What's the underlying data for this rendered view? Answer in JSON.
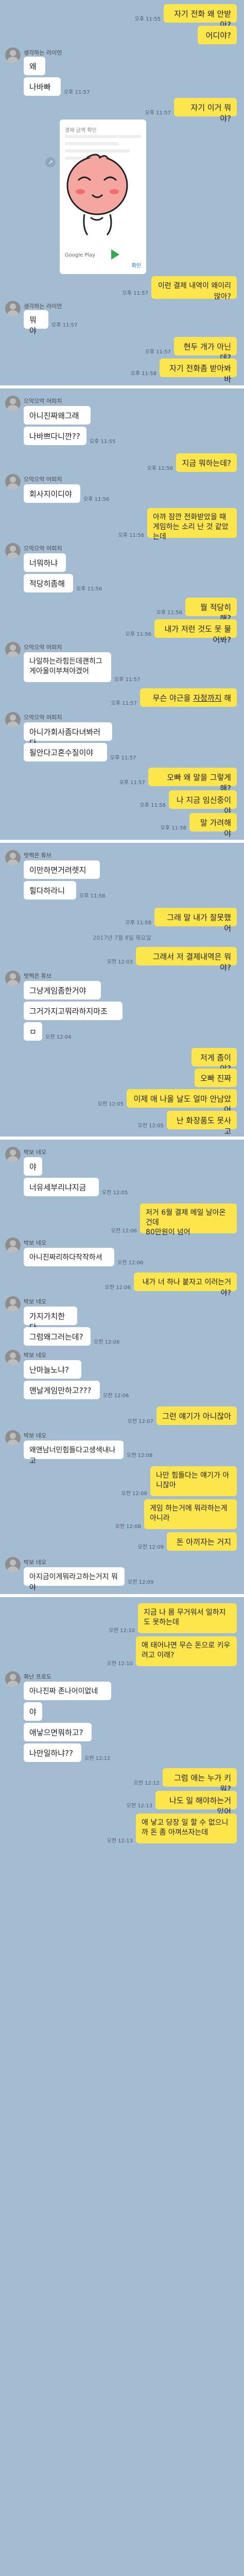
{
  "section1": {
    "m1": {
      "text": "자기 전화 왜 안받아?",
      "time": "오후 11:55"
    },
    "m2": {
      "text": "어디야?"
    },
    "name": "생각하는 라이언",
    "m3": {
      "text": "왜"
    },
    "m4": {
      "text": "나바빠",
      "time": "오후 11:57"
    },
    "m5": {
      "text": "자기 이거 뭐야?",
      "time": "오후 11:57"
    },
    "card": {
      "heading": "결제 금액 확인",
      "store": "Google Play",
      "cta": "확인"
    },
    "m6": {
      "text": "이런 결제 내역이 왜이리 많아?",
      "time": "오후 11:57"
    },
    "m7": {
      "text": "뭐야",
      "time": "오후 11:57"
    },
    "m8": {
      "text": "현두 개가 아닌데?",
      "time": "오후 11:57"
    },
    "m9": {
      "text": "자기 전화좀 받아봐바",
      "time": "오후 11:58"
    }
  },
  "section2": {
    "name": "으악으악 어피치",
    "m1": {
      "text": "아니진짜왜그래"
    },
    "m2": {
      "text": "나바쁘다니깐??",
      "time": "오후 11:55"
    },
    "m3": {
      "text": "지금 뭐하는데?",
      "time": "오후 11:56"
    },
    "m4": {
      "text": "회사지이디야",
      "time": "오후 11:56"
    },
    "m5": {
      "text": "아까 잠깐 전화받았을 때 게임하는 소리 난 것 같았는데",
      "time": "오후 11:56"
    },
    "m6": {
      "text": "너뭐하냐"
    },
    "m7": {
      "text": "적당히좀해",
      "time": "오후 11:56"
    },
    "m8": {
      "text": "뭘 적당히 해?",
      "time": "오후 11:56"
    },
    "m9": {
      "text": "내가 저런 것도 못 물어봐?",
      "time": "오후 11:56"
    },
    "m10": {
      "text": "나일하는라힘든데괜히그게아울이부쳐야겠어",
      "time": "오후 11:57"
    },
    "m11a": {
      "text": "무슨 야근을 "
    },
    "m11b": {
      "text": "자정까지"
    },
    "m11c": {
      "text": " 해",
      "time": "오후 11:57"
    },
    "m12": {
      "text": "아니가회사좀다녀봐러다"
    },
    "m13": {
      "text": "될안다고혼수질이야",
      "time": "오후 11:57"
    },
    "m14": {
      "text": "오빠 왜 말을 그렇게 해?",
      "time": "오후 11:57"
    },
    "m15": {
      "text": "나 지금 임신중이야",
      "time": "오후 11:58"
    },
    "m16": {
      "text": "말 가려해야",
      "time": "오후 11:58"
    }
  },
  "section3": {
    "name": "멋쩍은 튜브",
    "m1": {
      "text": "이만하면거려렛지"
    },
    "m2": {
      "text": "힐다하라니",
      "time": "오후 11:58"
    },
    "m3": {
      "text": "그래 말 내가 잘못했어",
      "time": "오후 11:58"
    },
    "date": "2017년 7월 8일 목요일",
    "m4": {
      "text": "그래서 저 결제내역은 뭐야?",
      "time": "오전 12:03"
    },
    "m5": {
      "text": "그냥게임좀한거야"
    },
    "m6": {
      "text": "그거가지고뭐라하지마조"
    },
    "m7": {
      "text": "ㅁ",
      "time": "오전 12:04"
    },
    "m8": {
      "text": "저게 좀이야?"
    },
    "m9": {
      "text": "오빠 진짜"
    },
    "m10": {
      "text": "이제 애 나올 날도 얼마 안남았어",
      "time": "오전 12:05"
    },
    "m11": {
      "text": "난 화장품도 못사고",
      "time": "오전 12:05"
    }
  },
  "section4": {
    "name": "박보 네오",
    "m1": {
      "text": "야"
    },
    "m2": {
      "text": "너유세부리냐지금",
      "time": "오전 12:05"
    },
    "m3": {
      "text": "저거 6월 결제 메일 날아온건데\n80만원이 넘어",
      "time": "오전 12:06"
    },
    "m4": {
      "text": "아니진짜리하다작작하셔",
      "time": "오전 12:06"
    },
    "m5": {
      "text": "내가 너 하나 붙자고 이러는거야?",
      "time": "오전 12:06"
    },
    "m6": {
      "text": "가지가치한다"
    },
    "m7": {
      "text": "그럼왜그러는데?",
      "time": "오전 12:06"
    },
    "m8": {
      "text": "난마늘노냐?"
    },
    "m9": {
      "text": "맨날게임만하고???",
      "time": "오전 12:06"
    },
    "m10": {
      "text": "그런 얘기가 아니잖아",
      "time": "오전 12:07"
    },
    "m11": {
      "text": "왜앤남너민힘들다고생색내나고",
      "time": "오전 12:08"
    },
    "m12": {
      "text": "나만 힘들다는 얘기가 아니잖아",
      "time": "오전 12:08"
    },
    "m13": {
      "text": "게임 하는거에 뭐라하는게 아니라",
      "time": "오전 12:08"
    },
    "m14": {
      "text": "돈 아끼자는 거지",
      "time": "오전 12:09"
    },
    "m15": {
      "text": "아지금이게뭐라고하는거지 뭐야",
      "time": "오전 12:09"
    }
  },
  "section5": {
    "m1": {
      "text": "지금 나 몸 무거워서 일하지도 못하는데",
      "time": "오전 12:10"
    },
    "m2": {
      "text": "애 태어나면 무슨 돈으로 키우려고 이래?",
      "time": "오전 12:10"
    },
    "name": "화난 프로도",
    "m3": {
      "text": "아나진짜 존나어이없네"
    },
    "m4": {
      "text": "야"
    },
    "m5": {
      "text": "애낳으면뭐하고?"
    },
    "m6": {
      "text": "나만일하냐??",
      "time": "오전 12:12"
    },
    "m7": {
      "text": "그럼 애는 누가 키워?",
      "time": "오전 12:12"
    },
    "m8": {
      "text": "나도 일 해야하는거 있어",
      "time": "오전 12:13"
    },
    "m9": {
      "text": "애 낳고 당장 일 할 수 없으니까 돈 좀 아껴쓰자는데",
      "time": "오전 12:13"
    }
  },
  "colors": {
    "background": "#a4bcd2",
    "my_bubble": "#fde64b",
    "their_bubble": "#ffffff"
  }
}
